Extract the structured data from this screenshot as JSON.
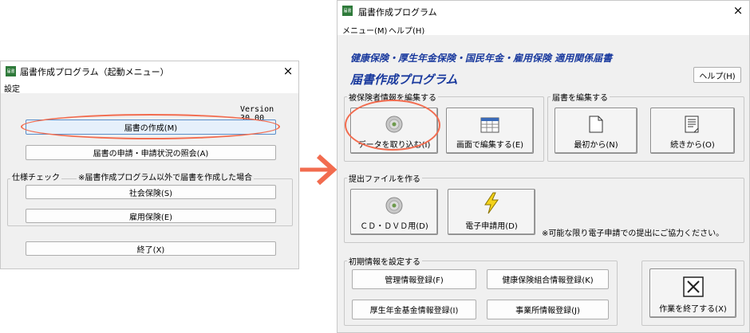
{
  "colors": {
    "annotation": "#f26c4f",
    "heading": "#1a3a9e",
    "window_bg": "#f0f0f0"
  },
  "left_window": {
    "icon_text": "届書",
    "title": "届書作成プログラム（起動メニュー）",
    "close_icon": "×",
    "menu": {
      "settings": "設定"
    },
    "version": "Version 30.00",
    "buttons": {
      "create": "届書の作成(M)",
      "inquiry": "届書の申請・申請状況の照会(A)",
      "social": "社会保険(S)",
      "employment": "雇用保険(E)",
      "exit": "終了(X)"
    },
    "spec_check": {
      "label": "仕様チェック",
      "note": "※届書作成プログラム以外で届書を作成した場合"
    }
  },
  "right_window": {
    "icon_text": "届書",
    "title": "届書作成プログラム",
    "close_icon": "×",
    "menu": {
      "menu": "メニュー(M)",
      "help": "ヘルプ(H)"
    },
    "heading": "健康保険・厚生年金保険・国民年金・雇用保険 適用関係届書",
    "subheading": "届書作成プログラム",
    "help_button": "ヘルプ(H)",
    "groups": {
      "edit_insured": {
        "label": "被保険者情報を編集する",
        "import": "データを取り込む(I)",
        "screen_edit": "画面で編集する(E)"
      },
      "edit_form": {
        "label": "届書を編集する",
        "new": "最初から(N)",
        "continue": "続きから(O)"
      },
      "submit_file": {
        "label": "提出ファイルを作る",
        "cd_dvd": "ＣＤ・ＤＶＤ用(D)",
        "e_apply": "電子申請用(D)",
        "note": "※可能な限り電子申請での提出にご協力ください。"
      },
      "initial": {
        "label": "初期情報を設定する",
        "admin": "管理情報登録(F)",
        "health_union": "健康保険組合情報登録(K)",
        "pension_fund": "厚生年金基金情報登録(I)",
        "office": "事業所情報登録(J)"
      },
      "exit": "作業を終了する(X)"
    }
  }
}
